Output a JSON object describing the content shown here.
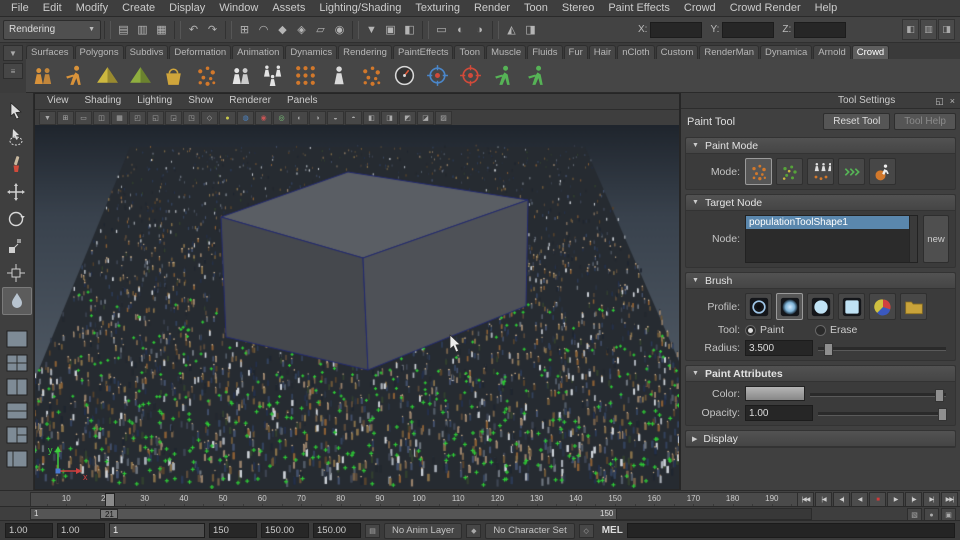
{
  "colors": {
    "selection_highlight": "#5a87ad",
    "paint_marker_green": "#2ecb36",
    "accent_orange": "#d2782b",
    "stop_red": "#cf3a3a"
  },
  "menubar": {
    "items": [
      "File",
      "Edit",
      "Modify",
      "Create",
      "Display",
      "Window",
      "Assets",
      "Lighting/Shading",
      "Texturing",
      "Render",
      "Toon",
      "Stereo",
      "Paint Effects",
      "Crowd",
      "Crowd Render",
      "Help"
    ]
  },
  "status_line": {
    "menu_set": "Rendering",
    "icon_groups": [
      [
        "new-scene",
        "open-scene",
        "save-scene"
      ],
      [
        "undo",
        "redo"
      ],
      [
        "snap-grid",
        "snap-curve",
        "snap-point",
        "snap-view",
        "snap-plane",
        "make-live"
      ],
      [
        "select-hierarchy",
        "select-object",
        "select-component"
      ],
      [
        "render-view",
        "ipr-render",
        "render-settings"
      ],
      [
        "paint-effects-panel",
        "hypershade-panel"
      ]
    ],
    "coord_fields": [
      {
        "label": "X:",
        "value": ""
      },
      {
        "label": "Y:",
        "value": ""
      },
      {
        "label": "Z:",
        "value": ""
      }
    ],
    "right_toggles": [
      "attribute-editor-toggle",
      "tool-settings-toggle",
      "channel-box-toggle"
    ]
  },
  "shelf": {
    "active_tab": "Crowd",
    "tabs": [
      "Surfaces",
      "Polygons",
      "Subdivs",
      "Deformation",
      "Animation",
      "Dynamics",
      "Rendering",
      "PaintEffects",
      "Toon",
      "Muscle",
      "Fluids",
      "Fur",
      "Hair",
      "nCloth",
      "Custom",
      "RenderMan",
      "Dynamica",
      "Arnold",
      "Crowd"
    ],
    "icons": [
      {
        "name": "entity-type",
        "style": "people",
        "color": "#d8923a"
      },
      {
        "name": "crowd-walk",
        "style": "runner",
        "color": "#d8923a"
      },
      {
        "name": "terrain-locator",
        "style": "pyramid",
        "color": "#cdb83f"
      },
      {
        "name": "nav-mesh",
        "style": "pyramid",
        "color": "#8fae3f"
      },
      {
        "name": "paint-bucket",
        "style": "bucket",
        "color": "#cfa53b"
      },
      {
        "name": "population-tool",
        "style": "dots",
        "color": "#d2782b"
      },
      {
        "name": "crowd-group",
        "style": "people",
        "color": "#e4e4e4"
      },
      {
        "name": "add-entities",
        "style": "people3",
        "color": "#e4e4e4"
      },
      {
        "name": "scatter-grid",
        "style": "griddots",
        "color": "#d2782b"
      },
      {
        "name": "mannequin",
        "style": "person",
        "color": "#dadada"
      },
      {
        "name": "scatter-sphere",
        "style": "dots",
        "color": "#d2782b"
      },
      {
        "name": "simulation-gauge",
        "style": "gauge",
        "color": "#d8d8d8"
      },
      {
        "name": "orient-target",
        "style": "target",
        "color": "#4a86c9"
      },
      {
        "name": "retarget-axis",
        "style": "target",
        "color": "#d24a3a"
      },
      {
        "name": "export-run",
        "style": "runner",
        "color": "#56b356"
      },
      {
        "name": "import-walk",
        "style": "runner",
        "color": "#56b356"
      }
    ]
  },
  "toolbox": {
    "tools": [
      {
        "name": "select-tool"
      },
      {
        "name": "lasso-select-tool"
      },
      {
        "name": "paint-select-tool"
      },
      {
        "name": "move-tool"
      },
      {
        "name": "rotate-tool"
      },
      {
        "name": "scale-tool"
      },
      {
        "name": "universal-manipulator-tool"
      },
      {
        "name": "paint-tool-current",
        "active": true
      }
    ],
    "layouts": [
      {
        "name": "single-pane-layout"
      },
      {
        "name": "four-pane-layout"
      },
      {
        "name": "two-pane-side-layout"
      },
      {
        "name": "two-pane-stacked-layout"
      },
      {
        "name": "three-pane-layout"
      },
      {
        "name": "outliner-persp-layout"
      }
    ]
  },
  "viewport": {
    "menus": [
      "View",
      "Shading",
      "Lighting",
      "Show",
      "Renderer",
      "Panels"
    ],
    "toolbar_icons": [
      "select-camera",
      "grid-toggle",
      "film-gate",
      "resolution-gate",
      "gate-mask",
      "field-chart",
      "safe-action",
      "safe-title",
      "frame-all",
      "wireframe",
      "smooth-shade",
      "textured-mode",
      "use-lights",
      "shadows-toggle",
      "screen-ao",
      "motion-blur",
      "multisample-aa",
      "depth-of-field",
      "isolate-select",
      "xray-mode",
      "exposure-control",
      "gamma-control",
      "background-gradient"
    ],
    "axis_labels": {
      "x": "x",
      "y": "y"
    }
  },
  "tool_settings": {
    "window_title": "Tool Settings",
    "tool_name": "Paint Tool",
    "reset_button": "Reset Tool",
    "help_button": "Tool Help",
    "paint_mode": {
      "title": "Paint Mode",
      "mode_label": "Mode:",
      "modes": [
        {
          "name": "place-mode",
          "active": true
        },
        {
          "name": "replace-mode",
          "active": false
        },
        {
          "name": "population-mode",
          "active": false
        },
        {
          "name": "orient-mode",
          "active": false
        },
        {
          "name": "animate-mode",
          "active": false
        }
      ]
    },
    "target_node": {
      "title": "Target Node",
      "node_label": "Node:",
      "items": [
        {
          "label": "populationToolShape1",
          "selected": true
        }
      ],
      "new_button": "new"
    },
    "brush": {
      "title": "Brush",
      "profile_label": "Profile:",
      "profiles": [
        {
          "name": "gaussian-profile",
          "active": false
        },
        {
          "name": "soft-profile",
          "active": true
        },
        {
          "name": "solid-profile",
          "active": false
        },
        {
          "name": "square-profile",
          "active": false
        },
        {
          "name": "color-wheel-profile",
          "active": false
        },
        {
          "name": "file-browse-profile",
          "active": false
        }
      ],
      "tool_label": "Tool:",
      "options": [
        {
          "label": "Paint",
          "selected": true
        },
        {
          "label": "Erase",
          "selected": false
        }
      ],
      "radius_label": "Radius:",
      "radius_value": "3.500",
      "radius_fraction": 0.08
    },
    "paint_attributes": {
      "title": "Paint Attributes",
      "color_label": "Color:",
      "color_fraction": 0.95,
      "opacity_label": "Opacity:",
      "opacity_value": "1.00",
      "opacity_fraction": 0.97
    },
    "display": {
      "title": "Display",
      "collapsed": true
    }
  },
  "timeline": {
    "start": 1,
    "end": 200,
    "label_step": 10,
    "current_frame": 21,
    "transport": [
      {
        "name": "go-to-start",
        "glyph": "|◀◀"
      },
      {
        "name": "step-back-frame",
        "glyph": "|◀"
      },
      {
        "name": "step-back-key",
        "glyph": "◀|"
      },
      {
        "name": "play-backwards",
        "glyph": "◀"
      },
      {
        "name": "stop-playback",
        "glyph": "■",
        "color": "#cf3a3a"
      },
      {
        "name": "play-forwards",
        "glyph": "▶"
      },
      {
        "name": "step-forward-key",
        "glyph": "|▶"
      },
      {
        "name": "step-forward-frame",
        "glyph": "▶|"
      },
      {
        "name": "go-to-end",
        "glyph": "▶▶|"
      }
    ]
  },
  "range_slider": {
    "start_label": "1",
    "end_label": "150",
    "handle_label": "21",
    "playback_fraction": 0.75
  },
  "status_bar": {
    "fields": [
      {
        "name": "anim-start-field",
        "value": "1.00",
        "wide": false
      },
      {
        "name": "playback-start-field",
        "value": "1.00",
        "wide": false
      },
      {
        "name": "playback-start-spin",
        "value": "1",
        "wide": true
      },
      {
        "name": "playback-end-spin",
        "value": "150",
        "wide": false
      },
      {
        "name": "playback-end-field",
        "value": "150.00",
        "wide": false
      },
      {
        "name": "anim-end-field",
        "value": "150.00",
        "wide": false
      }
    ],
    "anim_layer": "No Anim Layer",
    "character_set": "No Character Set",
    "mel_label": "MEL",
    "command_value": ""
  }
}
